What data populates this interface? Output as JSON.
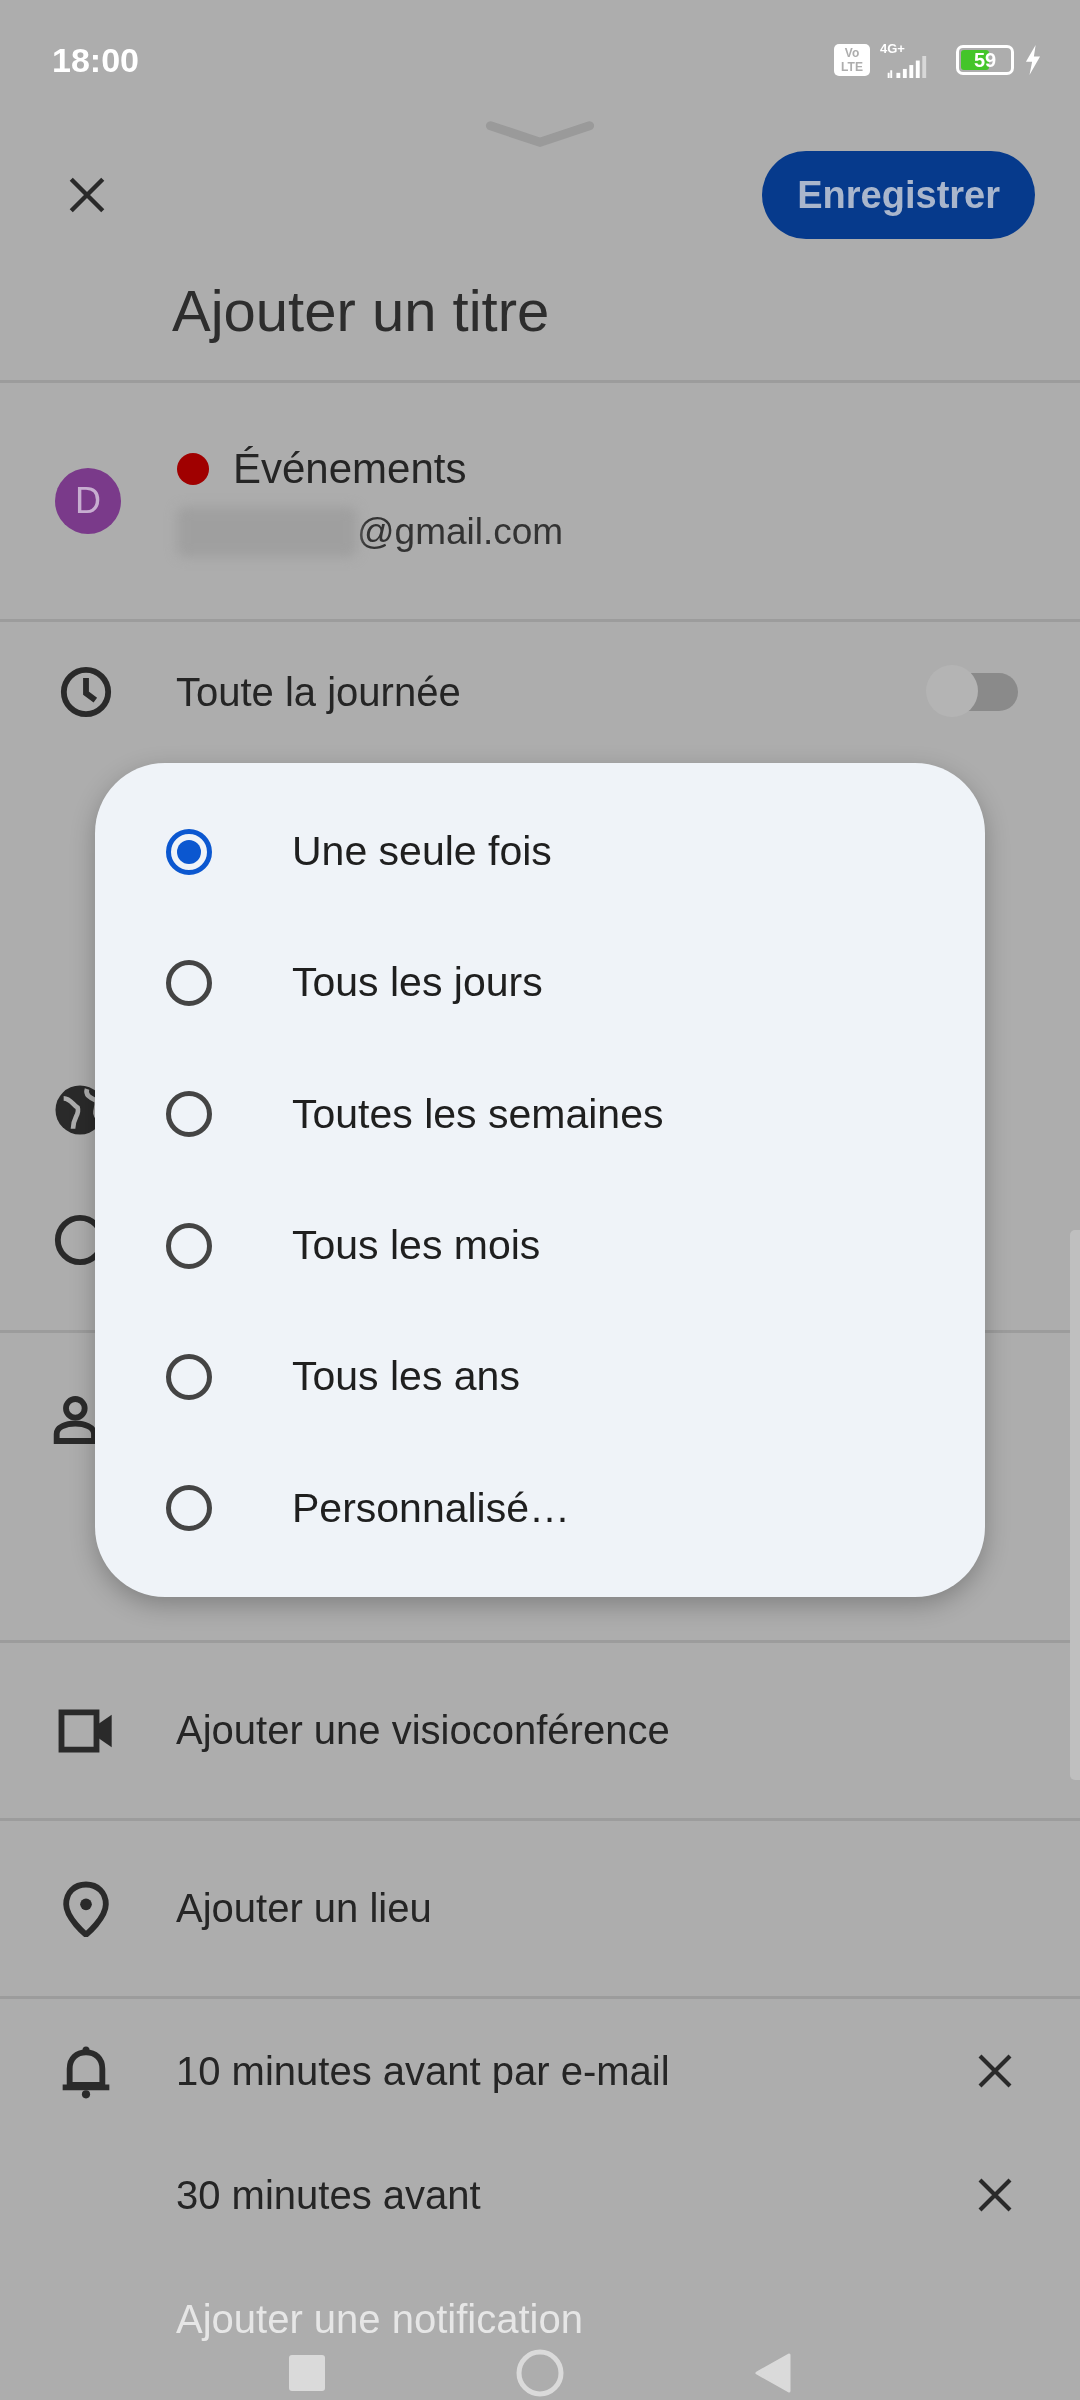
{
  "status_bar": {
    "time": "18:00",
    "volte_top": "Vo",
    "volte_bottom": "LTE",
    "network": "4G+",
    "battery": "59",
    "charging": true
  },
  "header": {
    "save_button": "Enregistrer",
    "title_placeholder": "Ajouter un titre"
  },
  "calendar": {
    "avatar": "D",
    "color": "#a00000",
    "name": "Événements",
    "email": "@gmail.com"
  },
  "all_day": {
    "label": "Toute la journée",
    "on": false
  },
  "repeat_dialog": {
    "options": [
      {
        "label": "Une seule fois",
        "selected": true
      },
      {
        "label": "Tous les jours",
        "selected": false
      },
      {
        "label": "Toutes les semaines",
        "selected": false
      },
      {
        "label": "Tous les mois",
        "selected": false
      },
      {
        "label": "Tous les ans",
        "selected": false
      },
      {
        "label": "Personnalisé…",
        "selected": false
      }
    ]
  },
  "rows": [
    {
      "kind": "video",
      "label": "Ajouter une visioconférence"
    },
    {
      "kind": "location",
      "label": "Ajouter un lieu"
    }
  ],
  "notifications": [
    {
      "label": "10 minutes avant par e-mail",
      "icon": true
    },
    {
      "label": "30 minutes avant",
      "icon": false
    }
  ],
  "add_notification": "Ajouter une notification"
}
